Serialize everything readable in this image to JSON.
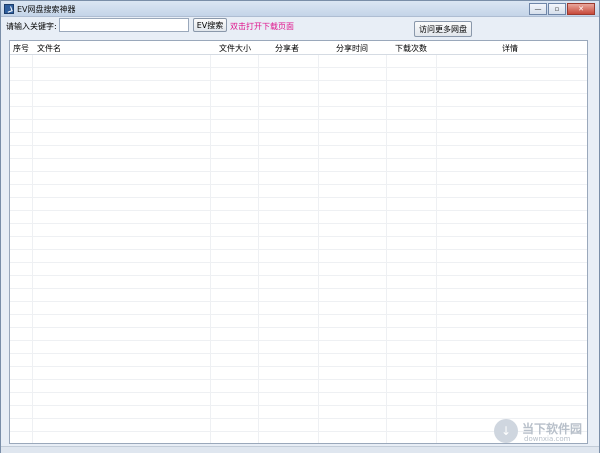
{
  "window": {
    "title": "EV网盘搜索神器"
  },
  "controls": {
    "minimize": "—",
    "restore": "▫",
    "close": "✕"
  },
  "toolbar": {
    "keyword_label": "请输入关键字:",
    "search_value": "",
    "search_placeholder": "",
    "search_button": "EV搜索",
    "hint": "双击打开下载页面",
    "more_button": "访问更多网盘"
  },
  "table": {
    "columns": [
      "序号",
      "文件名",
      "文件大小",
      "分享者",
      "分享时间",
      "下载次数",
      "详情"
    ],
    "rows": []
  },
  "watermark": {
    "name": "当下软件园",
    "url": "downxia.com"
  },
  "colors": {
    "hint": "#e0178d",
    "title_bar": "#c4d4e8"
  }
}
